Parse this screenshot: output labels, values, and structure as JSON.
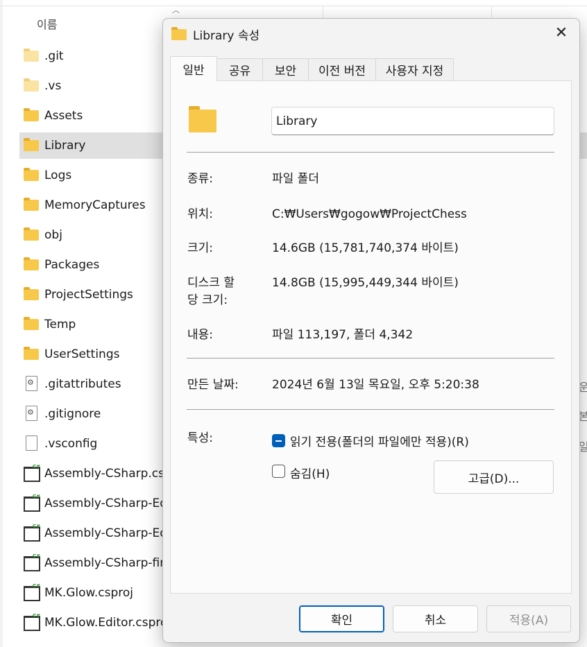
{
  "explorer": {
    "column_header": "이름",
    "files": [
      {
        "name": ".git",
        "icon": "folder-light-icon"
      },
      {
        "name": ".vs",
        "icon": "folder-light-icon"
      },
      {
        "name": "Assets",
        "icon": "folder-icon"
      },
      {
        "name": "Library",
        "icon": "folder-icon",
        "selected": true
      },
      {
        "name": "Logs",
        "icon": "folder-icon"
      },
      {
        "name": "MemoryCaptures",
        "icon": "folder-icon"
      },
      {
        "name": "obj",
        "icon": "folder-icon"
      },
      {
        "name": "Packages",
        "icon": "folder-icon"
      },
      {
        "name": "ProjectSettings",
        "icon": "folder-icon"
      },
      {
        "name": "Temp",
        "icon": "folder-icon"
      },
      {
        "name": "UserSettings",
        "icon": "folder-icon"
      },
      {
        "name": ".gitattributes",
        "icon": "settings-file-icon"
      },
      {
        "name": ".gitignore",
        "icon": "settings-file-icon"
      },
      {
        "name": ".vsconfig",
        "icon": "file-icon"
      },
      {
        "name": "Assembly-CSharp.csp",
        "icon": "csproj-icon"
      },
      {
        "name": "Assembly-CSharp-Ed",
        "icon": "csproj-icon"
      },
      {
        "name": "Assembly-CSharp-Ed",
        "icon": "csproj-icon"
      },
      {
        "name": "Assembly-CSharp-firs",
        "icon": "csproj-icon"
      },
      {
        "name": "MK.Glow.csproj",
        "icon": "csproj-icon"
      },
      {
        "name": "MK.Glow.Editor.csproj",
        "icon": "csproj-icon"
      }
    ],
    "right_clipped": [
      "운",
      "본",
      "일"
    ]
  },
  "dialog": {
    "title": "Library 속성",
    "tabs": [
      "일반",
      "공유",
      "보안",
      "이전 버전",
      "사용자 지정"
    ],
    "active_tab": "일반",
    "folder_name": "Library",
    "type_label": "종류:",
    "type_value": "파일 폴더",
    "location_label": "위치:",
    "location_value": "C:₩Users₩gogow₩ProjectChess",
    "size_label": "크기:",
    "size_value": "14.6GB (15,781,740,374 바이트)",
    "disk_size_label_1": "디스크 할",
    "disk_size_label_2": "당 크기:",
    "disk_size_value": "14.8GB (15,995,449,344 바이트)",
    "contents_label": "내용:",
    "contents_value": "파일 113,197, 폴더 4,342",
    "created_label": "만든 날짜:",
    "created_value": "2024년 6월 13일 목요일, 오후 5:20:38",
    "attributes_label": "특성:",
    "readonly_label": "읽기 전용(폴더의 파일에만 적용)(R)",
    "readonly_state": "indeterminate",
    "hidden_label": "숨김(H)",
    "hidden_state": "unchecked",
    "advanced_button": "고급(D)...",
    "ok_button": "확인",
    "cancel_button": "취소",
    "apply_button": "적용(A)"
  }
}
